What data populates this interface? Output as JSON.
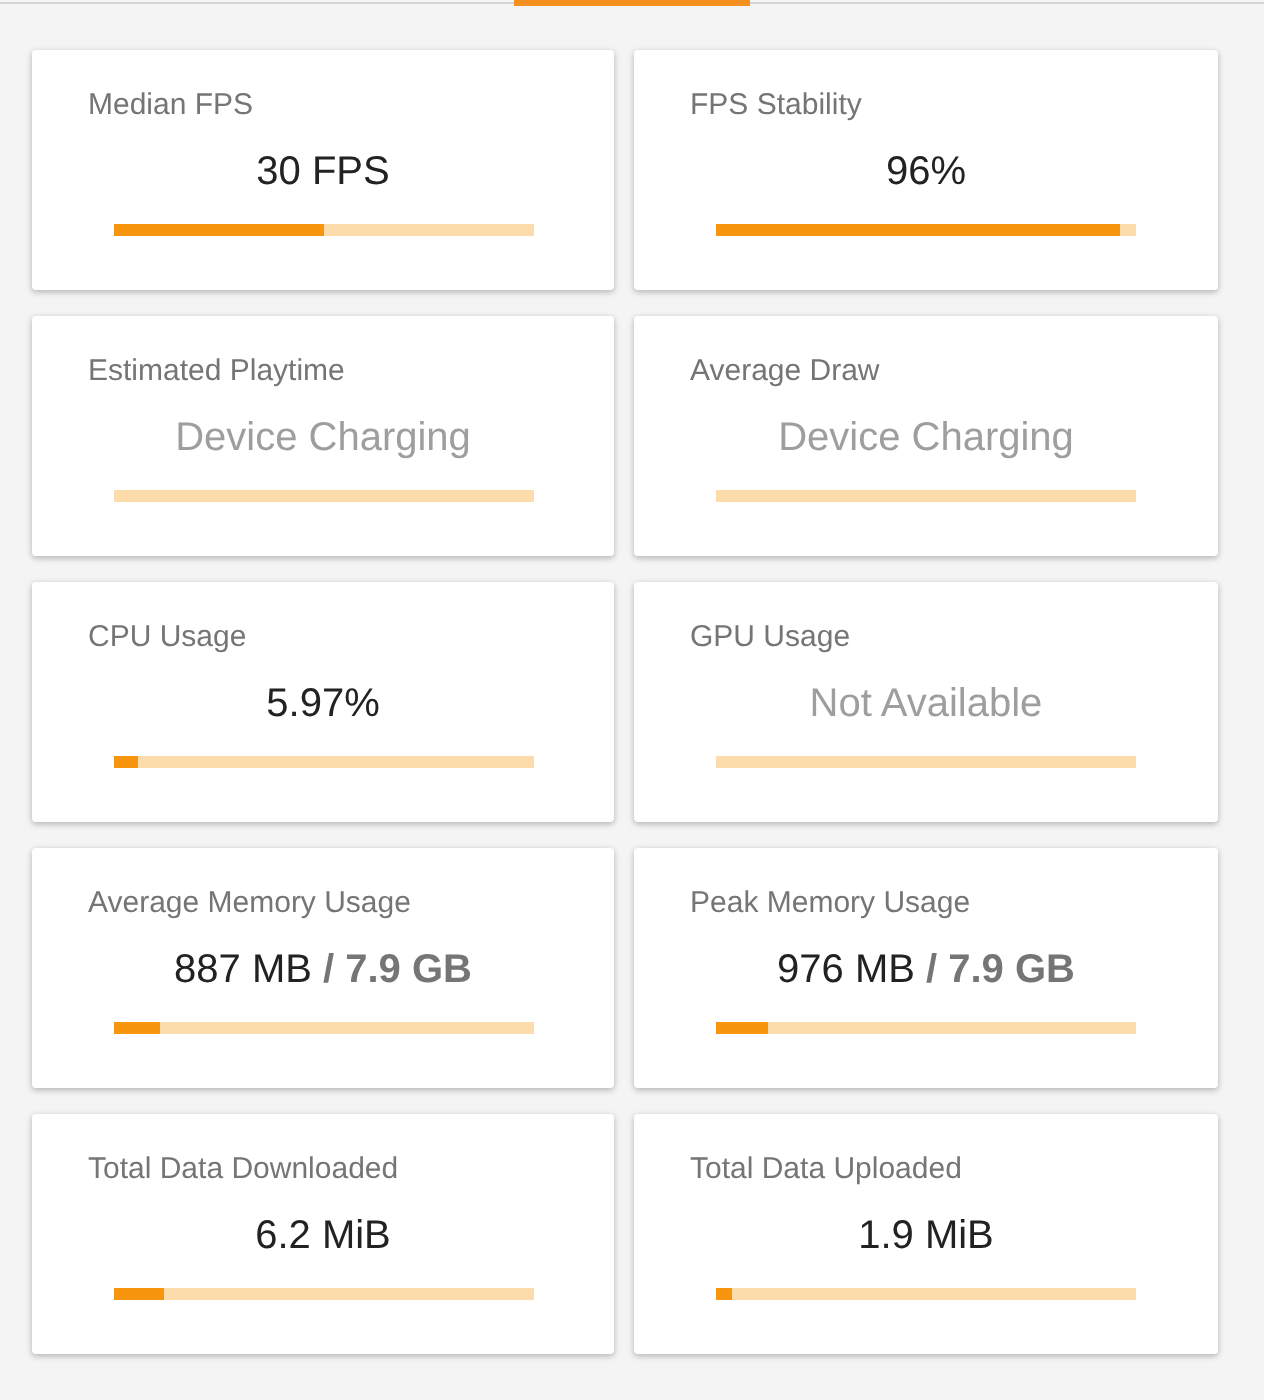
{
  "cards": [
    {
      "title": "Median FPS",
      "value": "30 FPS",
      "available": true,
      "level": 0.5
    },
    {
      "title": "FPS Stability",
      "value": "96%",
      "available": true,
      "level": 0.96
    },
    {
      "title": "Estimated Playtime",
      "value": "Device Charging",
      "available": false
    },
    {
      "title": "Average Draw",
      "value": "Device Charging",
      "available": false
    },
    {
      "title": "CPU Usage",
      "value": "5.97%",
      "available": true,
      "level": 0.06
    },
    {
      "title": "GPU Usage",
      "value": "Not Available",
      "available": false
    },
    {
      "title": "Average Memory Usage",
      "value": "887 MB **/ 7.9 GB**",
      "available": true,
      "level": 0.11
    },
    {
      "title": "Peak Memory Usage",
      "value": "976 MB **/ 7.9 GB**",
      "available": true,
      "level": 0.124
    },
    {
      "title": "Total Data Downloaded",
      "value": "6.2 MiB",
      "available": true,
      "level": 0.12
    },
    {
      "title": "Total Data Uploaded",
      "value": "1.9 MiB",
      "available": true,
      "level": 0.04
    }
  ]
}
